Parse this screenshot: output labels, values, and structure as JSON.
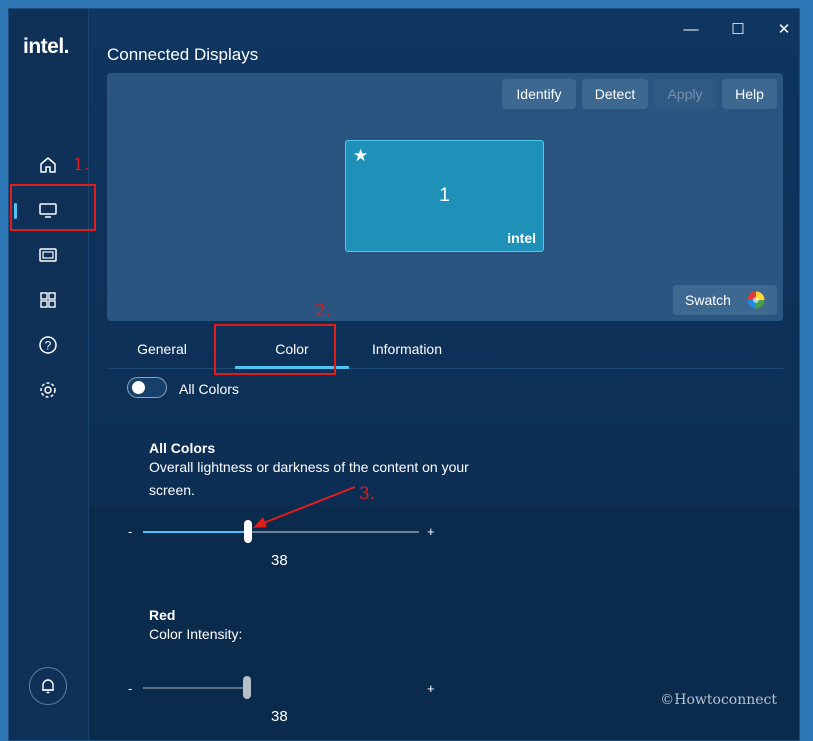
{
  "window": {
    "minimize": "—",
    "maximize": "☐",
    "close": "✕"
  },
  "sidebar": {
    "logo": "intel.",
    "items": [
      {
        "name": "home-icon"
      },
      {
        "name": "display-icon",
        "active": true
      },
      {
        "name": "video-icon"
      },
      {
        "name": "apps-grid-icon"
      },
      {
        "name": "help-icon"
      },
      {
        "name": "settings-icon"
      }
    ],
    "bell_icon": "bell-icon"
  },
  "header": {
    "title": "Connected Displays"
  },
  "preview": {
    "buttons": {
      "identify": "Identify",
      "detect": "Detect",
      "apply": "Apply",
      "help": "Help"
    },
    "monitor": {
      "number": "1",
      "star": "★",
      "logo": "intel"
    },
    "swatch_label": "Swatch"
  },
  "tabs": [
    {
      "label": "General",
      "active": false
    },
    {
      "label": "Color",
      "active": true
    },
    {
      "label": "Information",
      "active": false
    }
  ],
  "toggle": {
    "label": "All Colors",
    "on": false
  },
  "all_colors": {
    "title": "All Colors",
    "description": "Overall lightness or darkness of the content on your screen.",
    "minus": "-",
    "plus": "+",
    "value": "38",
    "fraction": 0.38
  },
  "red": {
    "title": "Red",
    "description": "Color Intensity:",
    "minus": "-",
    "plus": "+",
    "value": "38"
  },
  "annotations": {
    "step1": "1.",
    "step2": "2.",
    "step3": "3.",
    "color": "#e21b1b"
  },
  "watermark": "©Howtoconnect",
  "colors": {
    "accent": "#4fc3f7",
    "background": "#0e2e52",
    "monitor": "#1f91b8"
  }
}
